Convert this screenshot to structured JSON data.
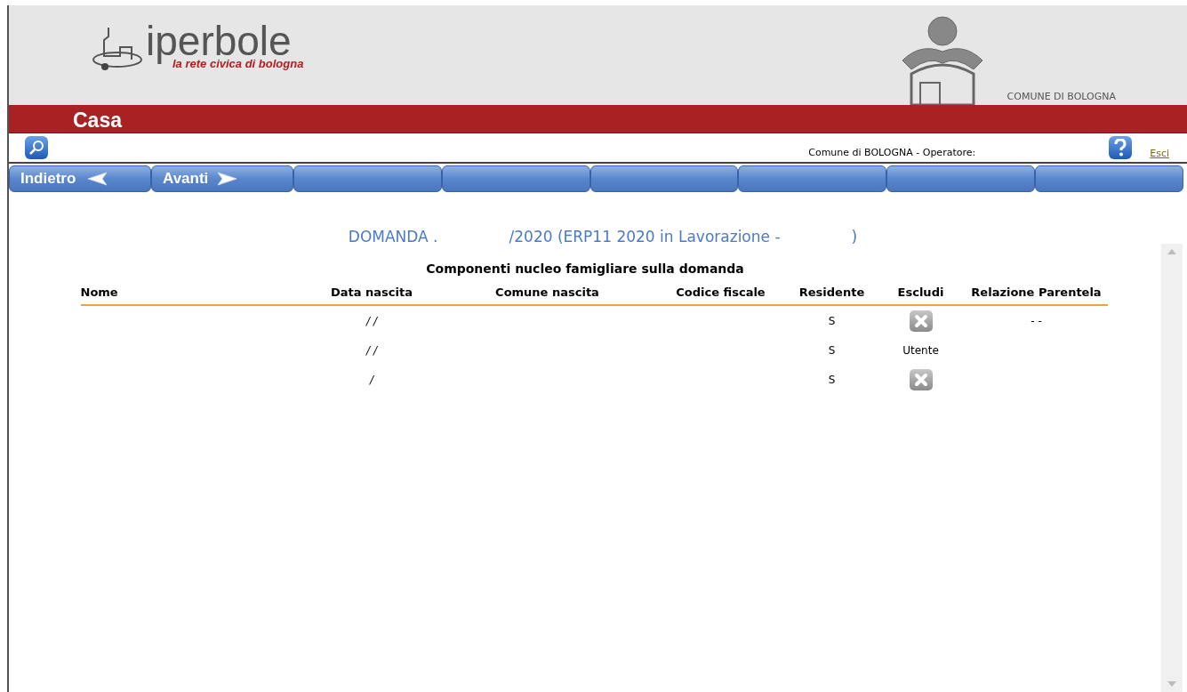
{
  "header": {
    "logo_name": "iperbole",
    "logo_tagline": "la rete civica di bologna",
    "crest_caption": "COMUNE DI BOLOGNA"
  },
  "section_title": "Casa",
  "toolbar": {
    "operator": "Comune di BOLOGNA - Operatore:",
    "exit_link": "Esci"
  },
  "nav": {
    "buttons": [
      {
        "label": "Indietro",
        "kind": "back"
      },
      {
        "label": "Avanti",
        "kind": "forward"
      },
      {
        "kind": "empty"
      },
      {
        "kind": "empty"
      },
      {
        "kind": "empty"
      },
      {
        "kind": "empty"
      },
      {
        "kind": "empty"
      },
      {
        "kind": "empty"
      }
    ]
  },
  "content": {
    "application_title": [
      "DOMANDA .",
      "/2020 (ERP11 2020 in Lavorazione -",
      ")"
    ],
    "table": {
      "caption": "Componenti nucleo famigliare sulla domanda",
      "columns": [
        "Nome",
        "Data nascita",
        "Comune nascita",
        "Codice fiscale",
        "Residente",
        "Escludi",
        "Relazione Parentela"
      ],
      "rows": [
        {
          "data_nascita": "/ /",
          "residente": "S",
          "escludi": {
            "kind": "button"
          },
          "relazione": "- -"
        },
        {
          "data_nascita": "/ /",
          "residente": "S",
          "escludi": {
            "kind": "text",
            "text": "Utente"
          }
        },
        {
          "data_nascita": "/",
          "residente": "S",
          "escludi": {
            "kind": "button"
          }
        }
      ]
    }
  }
}
